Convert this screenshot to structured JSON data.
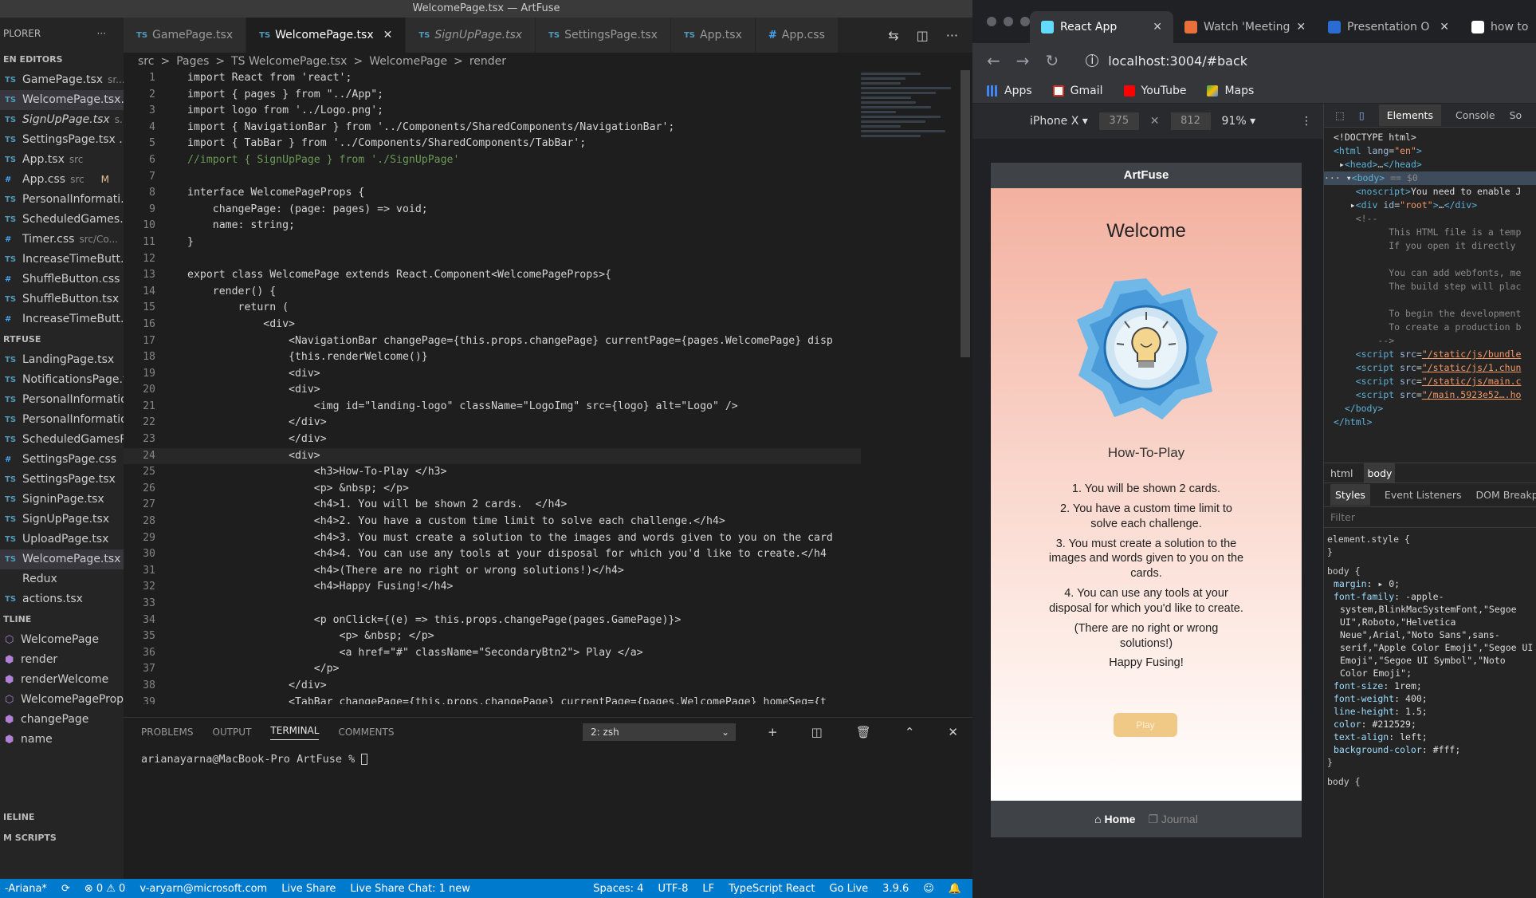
{
  "vscode": {
    "window_title": "WelcomePage.tsx — ArtFuse",
    "sidebar": {
      "explorer_label": "PLORER",
      "more": "···",
      "open_editors_label": "EN EDITORS",
      "open_editors": [
        {
          "type": "TS",
          "name": "GamePage.tsx",
          "desc": "sr...",
          "active": false,
          "italic": false,
          "status": ""
        },
        {
          "type": "TS",
          "name": "WelcomePage.tsx...",
          "desc": "",
          "active": true,
          "italic": false,
          "status": ""
        },
        {
          "type": "TS",
          "name": "SignUpPage.tsx",
          "desc": "s...",
          "active": false,
          "italic": true,
          "status": ""
        },
        {
          "type": "TS",
          "name": "SettingsPage.tsx ...",
          "desc": "",
          "active": false,
          "italic": false,
          "status": ""
        },
        {
          "type": "TS",
          "name": "App.tsx",
          "desc": "src",
          "active": false,
          "italic": false,
          "status": ""
        },
        {
          "type": "#",
          "name": "App.css",
          "desc": "src",
          "active": false,
          "italic": false,
          "status": "M"
        },
        {
          "type": "TS",
          "name": "PersonalInformati...",
          "desc": "",
          "active": false,
          "italic": false,
          "status": ""
        },
        {
          "type": "TS",
          "name": "ScheduledGames...",
          "desc": "",
          "active": false,
          "italic": false,
          "status": ""
        },
        {
          "type": "#",
          "name": "Timer.css",
          "desc": "src/Co...",
          "active": false,
          "italic": false,
          "status": ""
        },
        {
          "type": "TS",
          "name": "IncreaseTimeButt...",
          "desc": "",
          "active": false,
          "italic": false,
          "status": ""
        },
        {
          "type": "#",
          "name": "ShuffleButton.css ...",
          "desc": "",
          "active": false,
          "italic": false,
          "status": ""
        },
        {
          "type": "TS",
          "name": "ShuffleButton.tsx ...",
          "desc": "",
          "active": false,
          "italic": false,
          "status": ""
        },
        {
          "type": "#",
          "name": "IncreaseTimeButt...",
          "desc": "",
          "active": false,
          "italic": false,
          "status": ""
        }
      ],
      "project_label": "RTFUSE",
      "project_files": [
        {
          "type": "TS",
          "name": "LandingPage.tsx",
          "active": false
        },
        {
          "type": "TS",
          "name": "NotificationsPage.t...",
          "active": false
        },
        {
          "type": "TS",
          "name": "PersonalInformatio...",
          "active": false
        },
        {
          "type": "TS",
          "name": "PersonalInformatio...",
          "active": false
        },
        {
          "type": "TS",
          "name": "ScheduledGamesP...",
          "active": false
        },
        {
          "type": "#",
          "name": "SettingsPage.css",
          "active": false
        },
        {
          "type": "TS",
          "name": "SettingsPage.tsx",
          "active": false
        },
        {
          "type": "TS",
          "name": "SigninPage.tsx",
          "active": false
        },
        {
          "type": "TS",
          "name": "SignUpPage.tsx",
          "active": false
        },
        {
          "type": "TS",
          "name": "UploadPage.tsx",
          "active": false
        },
        {
          "type": "TS",
          "name": "WelcomePage.tsx",
          "active": true
        },
        {
          "type": "",
          "name": "Redux",
          "active": false
        },
        {
          "type": "TS",
          "name": "actions.tsx",
          "active": false
        }
      ],
      "outline_label": "TLINE",
      "outline": [
        "WelcomePage",
        "render",
        "renderWelcome",
        "WelcomePageProps",
        "changePage",
        "name"
      ],
      "timeline_label": "IELINE",
      "scripts_label": "M SCRIPTS"
    },
    "tabs": [
      {
        "type": "TS",
        "label": "GamePage.tsx",
        "active": false,
        "italic": false,
        "close": ""
      },
      {
        "type": "TS",
        "label": "WelcomePage.tsx",
        "active": true,
        "italic": false,
        "close": "✕"
      },
      {
        "type": "TS",
        "label": "SignUpPage.tsx",
        "active": false,
        "italic": true,
        "close": ""
      },
      {
        "type": "TS",
        "label": "SettingsPage.tsx",
        "active": false,
        "italic": false,
        "close": ""
      },
      {
        "type": "TS",
        "label": "App.tsx",
        "active": false,
        "italic": false,
        "close": ""
      },
      {
        "type": "#",
        "label": "App.css",
        "active": false,
        "italic": false,
        "close": ""
      }
    ],
    "breadcrumb": [
      "src",
      ">",
      "Pages",
      ">",
      "TS WelcomePage.tsx",
      ">",
      "WelcomePage",
      ">",
      "render"
    ],
    "code_lines": [
      "import React from 'react';",
      "import { pages } from \"../App\";",
      "import logo from '../Logo.png';",
      "import { NavigationBar } from '../Components/SharedComponents/NavigationBar';",
      "import { TabBar } from '../Components/SharedComponents/TabBar';",
      "//import { SignUpPage } from './SignUpPage'",
      "",
      "interface WelcomePageProps {",
      "    changePage: (page: pages) => void;",
      "    name: string;",
      "}",
      "",
      "export class WelcomePage extends React.Component<WelcomePageProps>{",
      "    render() {",
      "        return (",
      "            <div>",
      "                <NavigationBar changePage={this.props.changePage} currentPage={pages.WelcomePage} disp",
      "                {this.renderWelcome()}",
      "                <div>",
      "                <div>",
      "                    <img id=\"landing-logo\" className=\"LogoImg\" src={logo} alt=\"Logo\" />",
      "                </div>",
      "                </div>",
      "                <div>",
      "                    <h3>How-To-Play </h3>",
      "                    <p> &nbsp; </p>",
      "                    <h4>1. You will be shown 2 cards.  </h4>",
      "                    <h4>2. You have a custom time limit to solve each challenge.</h4>",
      "                    <h4>3. You must create a solution to the images and words given to you on the card",
      "                    <h4>4. You can use any tools at your disposal for which you'd like to create.</h4",
      "                    <h4>(There are no right or wrong solutions!)</h4>",
      "                    <h4>Happy Fusing!</h4>",
      "",
      "                    <p onClick={(e) => this.props.changePage(pages.GamePage)}>",
      "                        <p> &nbsp; </p>",
      "                        <a href=\"#\" className=\"SecondaryBtn2\"> Play </a>",
      "                    </p>",
      "                </div>",
      "                <TabBar changePage={this.props.changePage} currentPage={pages.WelcomePage} homeSeq={t"
    ],
    "line_numbers": [
      "1",
      "2",
      "3",
      "4",
      "5",
      "6",
      "7",
      "8",
      "9",
      "10",
      "11",
      "12",
      "13",
      "14",
      "15",
      "16",
      "17",
      "18",
      "19",
      "20",
      "21",
      "22",
      "23",
      "24",
      "25",
      "26",
      "27",
      "28",
      "29",
      "30",
      "31",
      "32",
      "33",
      "34",
      "35",
      "36",
      "37",
      "38",
      "39"
    ],
    "panel": {
      "tabs": [
        "PROBLEMS",
        "OUTPUT",
        "TERMINAL",
        "COMMENTS"
      ],
      "active_tab": "TERMINAL",
      "terminal_select": "2: zsh",
      "prompt": "arianayarna@MacBook-Pro ArtFuse % "
    },
    "statusbar": {
      "branch": "-Ariana*",
      "errors": "⊗ 0 ⚠ 0",
      "account": "v-aryarn@microsoft.com",
      "live_share": "Live Share",
      "live_chat": "Live Share Chat: 1 new",
      "spaces": "Spaces: 4",
      "encoding": "UTF-8",
      "eol": "LF",
      "language": "TypeScript React",
      "go_live": "Go Live",
      "ts_version": "3.9.6"
    }
  },
  "chrome": {
    "tabs": [
      {
        "title": "React App",
        "active": true,
        "color": "#61dafb"
      },
      {
        "title": "Watch 'Meeting",
        "active": false,
        "color": "#e8703a"
      },
      {
        "title": "Presentation O",
        "active": false,
        "color": "#2b6cd4"
      },
      {
        "title": "how to",
        "active": false,
        "color": "#ffffff"
      }
    ],
    "url": "localhost:3004/#back",
    "bookmarks": [
      "Apps",
      "Gmail",
      "YouTube",
      "Maps"
    ],
    "device": "iPhone X ▾",
    "width": "375",
    "height": "812",
    "zoom": "91% ▾",
    "app": {
      "header_title": "ArtFuse",
      "welcome": "Welcome",
      "howto_title": "How-To-Play",
      "rules": [
        "1. You will be shown 2 cards.",
        "2. You have a custom time limit to solve each challenge.",
        "3. You must create a solution to the images and words given to you on the cards.",
        "4. You can use any tools at your disposal for which you'd like to create.",
        "(There are no right or wrong solutions!)",
        "Happy Fusing!"
      ],
      "play_button": "Play",
      "nav_home": "Home",
      "nav_journal": "Journal"
    }
  },
  "devtools": {
    "tabs": [
      "Elements",
      "Console",
      "So"
    ],
    "active_tab": "Elements",
    "crumbs": [
      "html",
      "body"
    ],
    "style_tabs": [
      "Styles",
      "Event Listeners",
      "DOM Breakp"
    ],
    "filter_placeholder": "Filter",
    "element_style": "element.style {",
    "close_brace": "}",
    "body_rule_head": "body {",
    "body_props": [
      {
        "p": "margin",
        "v": "▸ 0;"
      },
      {
        "p": "font-family",
        "v": "-apple-system,BlinkMacSystemFont,\"Segoe UI\",Roboto,\"Helvetica Neue\",Arial,\"Noto Sans\",sans-serif,\"Apple Color Emoji\",\"Segoe UI Emoji\",\"Segoe UI Symbol\",\"Noto Color Emoji\";"
      },
      {
        "p": "font-size",
        "v": "1rem;"
      },
      {
        "p": "font-weight",
        "v": "400;"
      },
      {
        "p": "line-height",
        "v": "1.5;"
      },
      {
        "p": "color",
        "v": "#212529;"
      },
      {
        "p": "text-align",
        "v": "left;"
      },
      {
        "p": "background-color",
        "v": "#fff;"
      }
    ],
    "body_rule_tail": "body {"
  }
}
